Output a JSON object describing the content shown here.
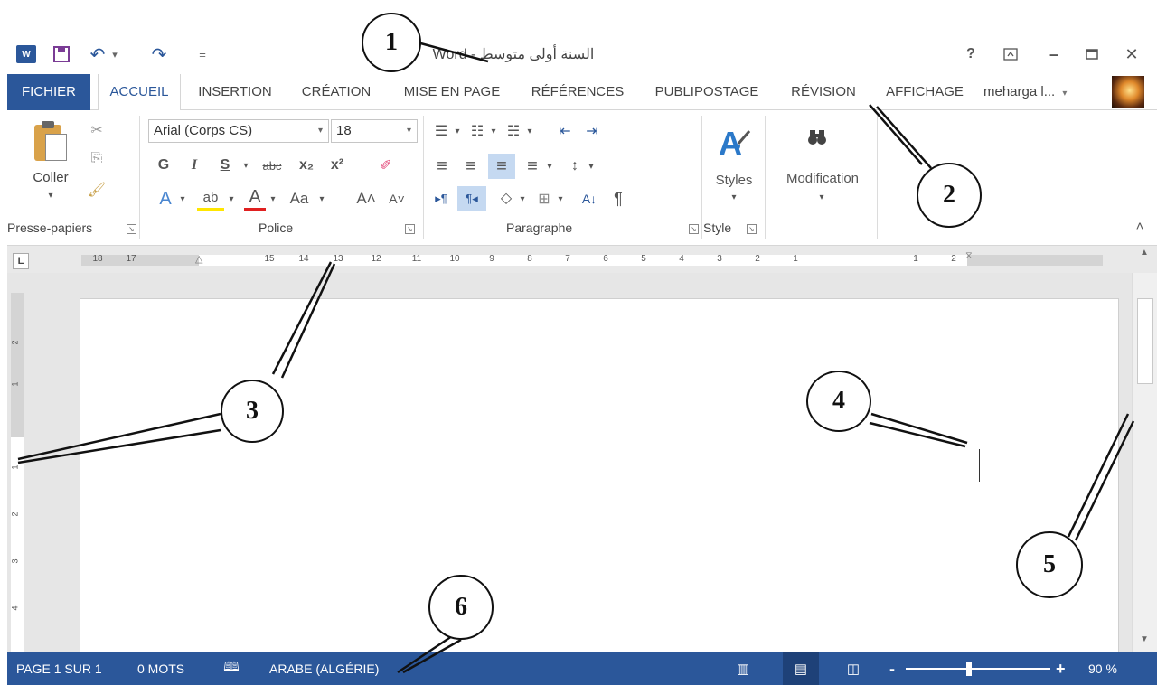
{
  "window": {
    "title": "السنة أولى متوسط - Word",
    "help": "?",
    "ribbon_display": "⊼",
    "minimize": "–",
    "maximize": "☐",
    "close": "✕"
  },
  "quick_access": {
    "word_logo": "W",
    "save": "💾",
    "undo": "↶",
    "undo_dd": "▾",
    "redo": "↷",
    "customize": "="
  },
  "tabs": [
    "FICHIER",
    "ACCUEIL",
    "INSERTION",
    "CRÉATION",
    "MISE EN PAGE",
    "RÉFÉRENCES",
    "PUBLIPOSTAGE",
    "RÉVISION",
    "AFFICHAGE"
  ],
  "user": {
    "name": "meharga l...",
    "dropdown": "▾"
  },
  "ribbon": {
    "clipboard": {
      "paste_label": "Coller",
      "paste_dd": "▾",
      "cut": "✂",
      "copy": "⎘",
      "format_painter": "🖌",
      "group_label": "Presse-papiers"
    },
    "font": {
      "font_name": "Arial (Corps CS)",
      "font_size": "18",
      "dd": "▾",
      "bold": "G",
      "italic": "I",
      "underline": "S",
      "strike": "abc",
      "subscript": "x₂",
      "superscript": "x²",
      "clear": "✐",
      "effects": "A",
      "highlight": "ab",
      "color": "A",
      "case": "Aa",
      "grow": "A˄",
      "shrink": "A˅",
      "group_label": "Police"
    },
    "paragraph": {
      "bullets": "☰",
      "numbering": "☷",
      "multilevel": "☵",
      "decrease_indent": "⇤",
      "increase_indent": "⇥",
      "align_left": "≡",
      "center": "≡",
      "align_right": "≡",
      "justify": "≡",
      "line_spacing": "↕",
      "ltr": "▸¶",
      "rtl": "¶◂",
      "shading": "◇",
      "borders": "⊞",
      "sort": "A↓",
      "show_marks": "¶",
      "group_label": "Paragraphe"
    },
    "styles": {
      "label": "Styles",
      "dd": "▾",
      "group_label": "Style"
    },
    "editing": {
      "label": "Modification",
      "dd": "▾"
    },
    "collapse": "˄",
    "launcher": "↘"
  },
  "ruler": {
    "corner": "L",
    "numbers": [
      "18",
      "17",
      "15",
      "14",
      "13",
      "12",
      "11",
      "10",
      "9",
      "8",
      "7",
      "6",
      "5",
      "4",
      "3",
      "2",
      "1",
      "1",
      "2"
    ],
    "vertical_numbers": [
      "2",
      "1",
      "1",
      "2",
      "3",
      "4"
    ]
  },
  "status": {
    "page": "PAGE 1 SUR 1",
    "words": "0 MOTS",
    "proofing_icon": "🕮",
    "language": "ARABE (ALGÉRIE)",
    "read_mode": "▥",
    "print_layout": "▤",
    "web_layout": "◫",
    "zoom_minus": "-",
    "zoom_plus": "+",
    "zoom": "90 %",
    "zoom_level": 0.45
  },
  "callouts": [
    "1",
    "2",
    "3",
    "4",
    "5",
    "6"
  ],
  "colors": {
    "accent": "#2b579a",
    "ribbon_bg": "#ffffff",
    "doc_bg": "#e6e6e6"
  }
}
